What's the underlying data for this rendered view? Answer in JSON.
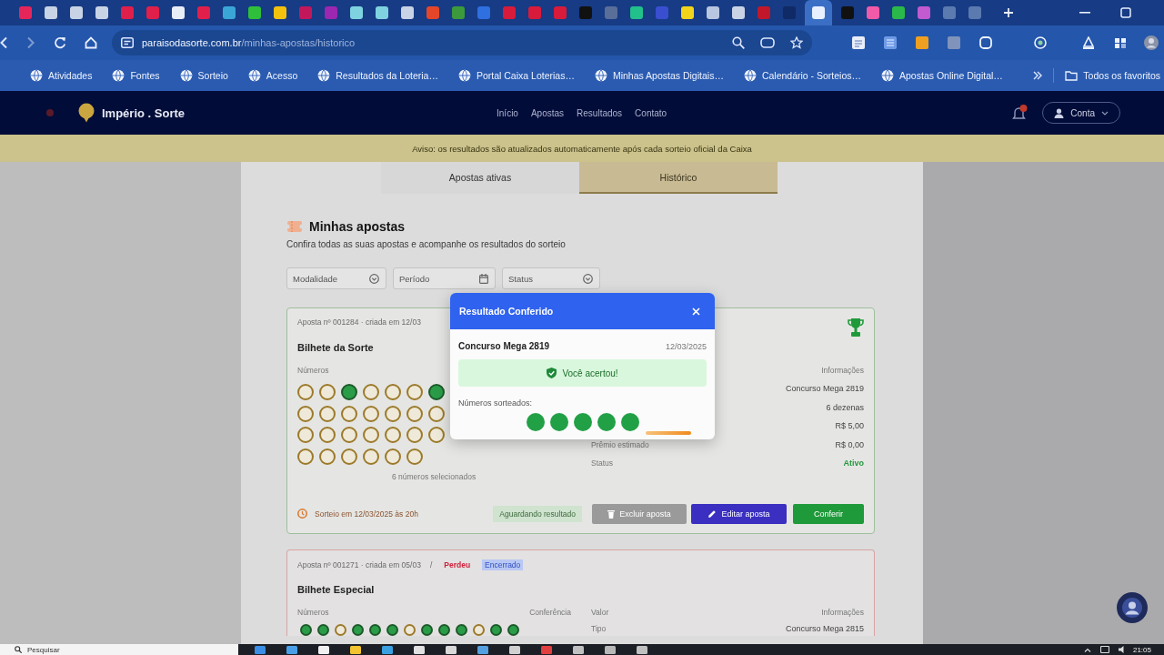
{
  "browser": {
    "tabs": [
      {
        "color": "#e6265a",
        "selected": false
      },
      {
        "color": "#c9d3e6",
        "selected": false
      },
      {
        "color": "#c9d3e6",
        "selected": false
      },
      {
        "color": "#c9d3e6",
        "selected": false
      },
      {
        "color": "#e0204a",
        "selected": false
      },
      {
        "color": "#e0204a",
        "selected": false
      },
      {
        "color": "#e8eef8",
        "selected": false
      },
      {
        "color": "#e0204a",
        "selected": false
      },
      {
        "color": "#3aa6d8",
        "selected": false
      },
      {
        "color": "#2fbf3a",
        "selected": false
      },
      {
        "color": "#f4c20d",
        "selected": false
      },
      {
        "color": "#c2185b",
        "selected": false
      },
      {
        "color": "#9c27b0",
        "selected": false
      },
      {
        "color": "#7fd3e0",
        "selected": false
      },
      {
        "color": "#7fd3e0",
        "selected": false
      },
      {
        "color": "#c9d3e6",
        "selected": false
      },
      {
        "color": "#e5462a",
        "selected": false
      },
      {
        "color": "#3c9a3c",
        "selected": false
      },
      {
        "color": "#2f6fe0",
        "selected": false
      },
      {
        "color": "#d81b3a",
        "selected": false
      },
      {
        "color": "#d81b3a",
        "selected": false
      },
      {
        "color": "#d81b3a",
        "selected": false
      },
      {
        "color": "#111111",
        "selected": false
      },
      {
        "color": "#5a6e9a",
        "selected": false
      },
      {
        "color": "#22c08a",
        "selected": false
      },
      {
        "color": "#3a4fd0",
        "selected": false
      },
      {
        "color": "#f2d51a",
        "selected": false
      },
      {
        "color": "#b8c6e0",
        "selected": false
      },
      {
        "color": "#c9d3e6",
        "selected": false
      },
      {
        "color": "#c0182a",
        "selected": false
      },
      {
        "color": "#0f2a66",
        "selected": false
      },
      {
        "color": "#e8f0ff",
        "selected": true
      },
      {
        "color": "#111111",
        "selected": false
      },
      {
        "color": "#f05aa8",
        "selected": false
      },
      {
        "color": "#2ab84a",
        "selected": false
      },
      {
        "color": "#c25ad0",
        "selected": false
      },
      {
        "color": "#5a7ab0",
        "selected": false
      },
      {
        "color": "#5a7ab0",
        "selected": false
      }
    ],
    "address_bar": {
      "host": "paraisodasorte.com.br",
      "path": "/minhas-apostas/historico"
    },
    "bookmarks": [
      {
        "label": "Atividades"
      },
      {
        "label": "Fontes"
      },
      {
        "label": "Sorteio"
      },
      {
        "label": "Acesso"
      },
      {
        "label": "Resultados da Loteria…"
      },
      {
        "label": "Portal Caixa Loterias…"
      },
      {
        "label": "Minhas Apostas Digitais…"
      },
      {
        "label": "Calendário - Sorteios…"
      },
      {
        "label": "Apostas Online Digital…"
      }
    ],
    "bookmarks_folder": "Todos os favoritos"
  },
  "site": {
    "brand": "Império . Sorte",
    "nav": [
      {
        "label": "Início"
      },
      {
        "label": "Apostas"
      },
      {
        "label": "Resultados"
      },
      {
        "label": "Contato"
      }
    ],
    "account_button": "Conta",
    "banner": "Aviso: os resultados são atualizados automaticamente após cada sorteio oficial da Caixa"
  },
  "page": {
    "tabs": [
      {
        "label": "Apostas ativas",
        "selected": false
      },
      {
        "label": "Histórico",
        "selected": true
      }
    ],
    "title": "Minhas apostas",
    "subtitle": "Confira todas as suas apostas e acompanhe os resultados do sorteio",
    "filters": [
      {
        "placeholder": "Modalidade",
        "kind": "select"
      },
      {
        "placeholder": "Período",
        "kind": "date"
      },
      {
        "placeholder": "Status",
        "kind": "select"
      }
    ],
    "bets": [
      {
        "kind": "active",
        "meta": "Aposta nº 001284 · criada em 12/03",
        "trophy": true,
        "title": "Bilhete da Sorte",
        "numbers_label": "Números",
        "number_rows": [
          [
            {
              "selected": false
            },
            {
              "selected": false
            },
            {
              "selected": true
            },
            {
              "selected": false
            },
            {
              "selected": false
            },
            {
              "selected": false
            },
            {
              "selected": true
            }
          ],
          [
            {
              "selected": false
            },
            {
              "selected": false
            },
            {
              "selected": false
            },
            {
              "selected": false
            },
            {
              "selected": false
            },
            {
              "selected": false
            },
            {
              "selected": false
            }
          ],
          [
            {
              "selected": false
            },
            {
              "selected": false
            },
            {
              "selected": false
            },
            {
              "selected": false
            },
            {
              "selected": false
            },
            {
              "selected": false
            },
            {
              "selected": false
            }
          ],
          [
            {
              "selected": false
            },
            {
              "selected": false
            },
            {
              "selected": false
            },
            {
              "selected": false
            },
            {
              "selected": false
            },
            {
              "selected": false
            }
          ]
        ],
        "caption": "6 números selecionados",
        "details_heading": {
          "text": "Informações"
        },
        "details": [
          {
            "value": "Concurso Mega 2819"
          },
          {
            "value": "6 dezenas"
          },
          {
            "value": "R$ 5,00"
          },
          {
            "label": "Prêmio estimado",
            "value": "R$ 0,00"
          },
          {
            "label": "Status",
            "value": "Ativo",
            "kind": "status"
          }
        ],
        "footer_note": "Sorteio em 12/03/2025 às 20h",
        "result_badge": "Aguardando resultado",
        "actions": [
          {
            "label": "Excluir aposta",
            "kind": "delete"
          },
          {
            "label": "Editar aposta",
            "kind": "edit"
          },
          {
            "label": "Conferir",
            "kind": "check"
          }
        ]
      },
      {
        "kind": "closed",
        "meta": "Aposta nº 001271 · criada em 05/03",
        "separator": "/",
        "tags": [
          {
            "label": "Perdeu",
            "kind": "lost"
          },
          {
            "label": "Encerrado",
            "kind": "closed"
          }
        ],
        "title": "Bilhete Especial",
        "numbers_label": "Números",
        "numbers_note": "Conferência",
        "number_rows": [
          [
            {
              "selected": true
            },
            {
              "selected": true
            },
            {
              "selected": false
            },
            {
              "selected": true
            },
            {
              "selected": true
            },
            {
              "selected": true
            },
            {
              "selected": false
            },
            {
              "selected": true
            },
            {
              "selected": true
            },
            {
              "selected": true
            },
            {
              "selected": false
            },
            {
              "selected": true
            },
            {
              "selected": true
            }
          ]
        ],
        "details_heading": {
          "label": "Valor",
          "text": "Informações"
        },
        "details": [
          {
            "label": "Tipo",
            "value": "Concurso Mega 2815"
          }
        ]
      }
    ]
  },
  "modal": {
    "title": "Resultado Conferido",
    "contest": "Concurso Mega 2819",
    "date": "12/03/2025",
    "message": "Você acertou!",
    "drawn_label": "Números sorteados:",
    "drawn_balls": [
      {
        "color": "#22a046"
      },
      {
        "color": "#22a046"
      },
      {
        "color": "#22a046"
      },
      {
        "color": "#22a046"
      },
      {
        "color": "#22a046"
      }
    ]
  },
  "taskbar": {
    "search_placeholder": "Pesquisar",
    "clock": "21:05"
  }
}
